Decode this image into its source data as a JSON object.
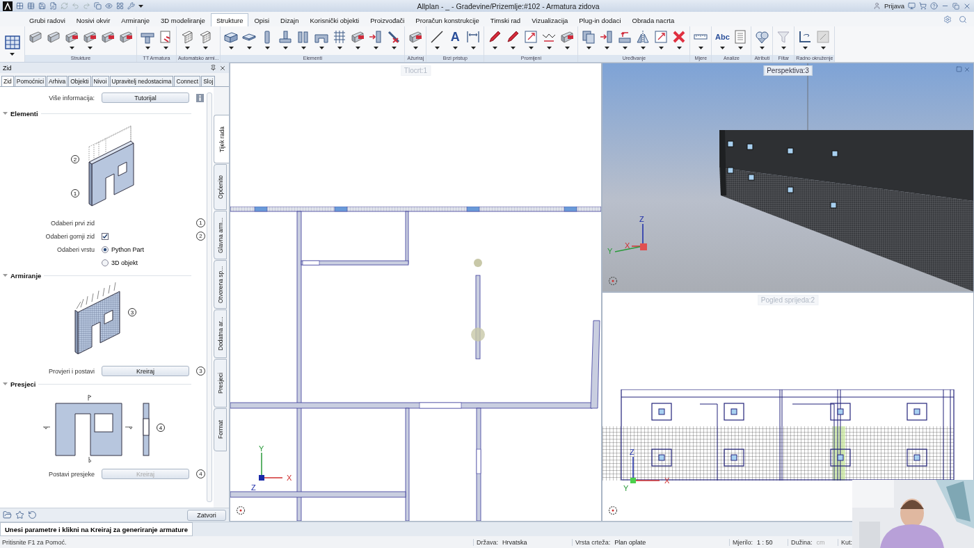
{
  "title_bar": {
    "title": "Allplan - _ - Građevine/Prizemlje:#102 - Armatura zidova",
    "user": "Prijava"
  },
  "menu_tabs": [
    {
      "label": "Grubi radovi",
      "selected": false
    },
    {
      "label": "Nosivi okvir",
      "selected": false
    },
    {
      "label": "Armiranje",
      "selected": false
    },
    {
      "label": "3D modeliranje",
      "selected": false
    },
    {
      "label": "Strukture",
      "selected": true
    },
    {
      "label": "Opisi",
      "selected": false
    },
    {
      "label": "Dizajn",
      "selected": false
    },
    {
      "label": "Korisnički objekti",
      "selected": false
    },
    {
      "label": "Proizvođači",
      "selected": false
    },
    {
      "label": "Proračun konstrukcije",
      "selected": false
    },
    {
      "label": "Timski rad",
      "selected": false
    },
    {
      "label": "Vizualizacija",
      "selected": false
    },
    {
      "label": "Plug-in dodaci",
      "selected": false
    },
    {
      "label": "Obrada nacrta",
      "selected": false
    }
  ],
  "ribbon": {
    "groups": [
      {
        "label": "Strukture",
        "buttons": [
          {
            "dropdown": false
          },
          {
            "dropdown": false
          },
          {
            "dropdown": true
          },
          {
            "dropdown": true
          },
          {
            "dropdown": false
          },
          {
            "dropdown": false
          }
        ]
      },
      {
        "label": "TT Armatura",
        "buttons": [
          {
            "dropdown": true
          },
          {
            "dropdown": true
          }
        ]
      },
      {
        "label": "Automatsko armi...",
        "buttons": [
          {
            "dropdown": true
          },
          {
            "dropdown": true
          }
        ]
      },
      {
        "label": "Elementi",
        "buttons": [
          {
            "dropdown": true
          },
          {
            "dropdown": true
          },
          {
            "dropdown": true
          },
          {
            "dropdown": true
          },
          {
            "dropdown": true
          },
          {
            "dropdown": true
          },
          {
            "dropdown": true
          },
          {
            "dropdown": true
          },
          {
            "dropdown": true
          },
          {
            "dropdown": true
          }
        ]
      },
      {
        "label": "Ažuriraj",
        "buttons": [
          {
            "dropdown": true
          }
        ]
      },
      {
        "label": "Brzi pristup",
        "buttons": [
          {
            "dropdown": true
          },
          {
            "dropdown": true,
            "glyph": "A"
          },
          {
            "dropdown": true
          }
        ]
      },
      {
        "label": "Promijeni",
        "buttons": [
          {
            "dropdown": true
          },
          {
            "dropdown": true
          },
          {
            "dropdown": true
          },
          {
            "dropdown": true
          },
          {
            "dropdown": true
          }
        ]
      },
      {
        "label": "Uređivanje",
        "buttons": [
          {
            "dropdown": true
          },
          {
            "dropdown": true
          },
          {
            "dropdown": true
          },
          {
            "dropdown": true
          },
          {
            "dropdown": true
          },
          {
            "dropdown": true
          }
        ]
      },
      {
        "label": "Mjere",
        "buttons": [
          {
            "dropdown": true
          }
        ]
      },
      {
        "label": "Analize",
        "buttons": [
          {
            "dropdown": true,
            "glyph": "Abc"
          },
          {
            "dropdown": true
          }
        ]
      },
      {
        "label": "Atributi",
        "buttons": [
          {
            "dropdown": true
          }
        ]
      },
      {
        "label": "Filtar",
        "buttons": [
          {
            "dropdown": true
          }
        ]
      },
      {
        "label": "Radno okruženje",
        "buttons": [
          {
            "dropdown": true
          },
          {
            "dropdown": true
          }
        ]
      }
    ]
  },
  "panel": {
    "title": "Zid",
    "tabs": [
      {
        "label": "Zid",
        "selected": true
      },
      {
        "label": "Pomoćnici",
        "selected": false
      },
      {
        "label": "Arhiva",
        "selected": false
      },
      {
        "label": "Objekti",
        "selected": false
      },
      {
        "label": "Nivoi",
        "selected": false
      },
      {
        "label": "Upravitelj nedostacima",
        "selected": false
      },
      {
        "label": "Connect",
        "selected": false
      },
      {
        "label": "Sloj",
        "selected": false
      }
    ],
    "side_tabs": [
      {
        "label": "Tijek rada",
        "selected": true
      },
      {
        "label": "Općenito",
        "selected": false
      },
      {
        "label": "Glavna arm...",
        "selected": false
      },
      {
        "label": "Otvorena sp...",
        "selected": false
      },
      {
        "label": "Dodatna ar...",
        "selected": false
      },
      {
        "label": "Presjeci",
        "selected": false
      },
      {
        "label": "Format",
        "selected": false
      }
    ],
    "info": {
      "label": "Više informacija:",
      "button": "Tutorijal"
    },
    "sections": [
      {
        "title": "Elementi",
        "kind": "wall",
        "callouts": [
          "2",
          "1"
        ],
        "rows": [
          {
            "kind": "callout",
            "label": "Odaberi prvi zid",
            "callout": "1"
          },
          {
            "kind": "checkbox",
            "label": "Odaberi gornji zid",
            "checked": true,
            "callout": "2"
          },
          {
            "kind": "radio",
            "label": "Odaberi vrstu",
            "options": [
              {
                "label": "Python Part",
                "selected": true
              },
              {
                "label": "3D objekt",
                "selected": false
              }
            ]
          }
        ]
      },
      {
        "title": "Armiranje",
        "kind": "reinforced",
        "callouts": [
          "3"
        ],
        "rows": [
          {
            "kind": "button",
            "label": "Provjeri i postavi",
            "button": "Kreiraj",
            "disabled": false,
            "callout": "3"
          }
        ]
      },
      {
        "title": "Presjeci",
        "kind": "sections",
        "callouts": [
          "4"
        ],
        "rows": [
          {
            "kind": "button",
            "label": "Postavi presjeke",
            "button": "Kreiraj",
            "disabled": true,
            "callout": "4"
          }
        ]
      }
    ],
    "close_button": "Zatvori"
  },
  "viewports": [
    {
      "kind": "plan",
      "label": "Tlocrt:1",
      "active": false,
      "axes": {
        "x": "X",
        "y": "Y",
        "z": "Z"
      }
    },
    {
      "kind": "perspective",
      "label": "Perspektiva:3",
      "active": true,
      "axes": {
        "x": "X",
        "y": "Y",
        "z": "Z"
      }
    },
    {
      "kind": "front",
      "label": "Pogled sprijeda:2",
      "active": false,
      "axes": {
        "x": "X",
        "y": "Y",
        "z": "Z"
      }
    }
  ],
  "prompt": "Unesi parametre i klikni na Kreiraj za generiranje armature",
  "status_bar": {
    "help": "Pritisnite F1 za Pomoć.",
    "fields": [
      {
        "label": "Država:",
        "value": "Hrvatska"
      },
      {
        "label": "Vrsta crteža:",
        "value": "Plan oplate"
      },
      {
        "label": "Mjerilo:",
        "value": "1 : 50"
      },
      {
        "label": "Dužina:",
        "value": "cm"
      },
      {
        "label": "Kut:"
      }
    ]
  }
}
